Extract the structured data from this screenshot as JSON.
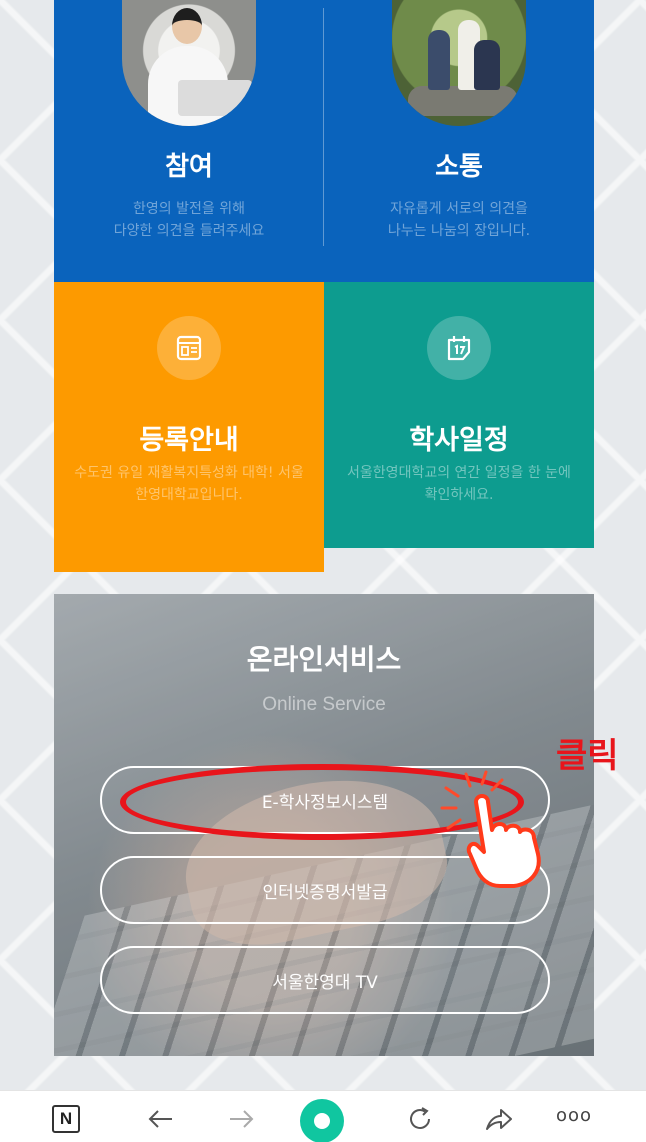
{
  "tiles": {
    "participation": {
      "title": "참여",
      "desc_line1": "한영의 발전을 위해",
      "desc_line2": "다양한 의견을 들려주세요"
    },
    "communication": {
      "title": "소통",
      "desc_line1": "자유롭게 서로의 의견을",
      "desc_line2": "나누는 나눔의 장입니다."
    },
    "registration": {
      "title": "등록안내",
      "desc": "수도권 유일 재활복지특성화 대학! 서울한영대학교입니다."
    },
    "schedule": {
      "title": "학사일정",
      "desc": "서울한영대학교의 연간 일정을 한 눈에 확인하세요."
    }
  },
  "online_service": {
    "title": "온라인서비스",
    "subtitle": "Online Service",
    "buttons": [
      "E-학사정보시스템",
      "인터넷증명서발급",
      "서울한영대 TV"
    ]
  },
  "annotation": {
    "click_label": "클릭"
  },
  "browser_toolbar": {
    "n_label": "N",
    "more_label": "ooo"
  },
  "colors": {
    "blue": "#0a63bc",
    "orange": "#fd9a00",
    "teal": "#0d9c8f",
    "annotation_red": "#e8151b",
    "home_green": "#10c6a0"
  }
}
